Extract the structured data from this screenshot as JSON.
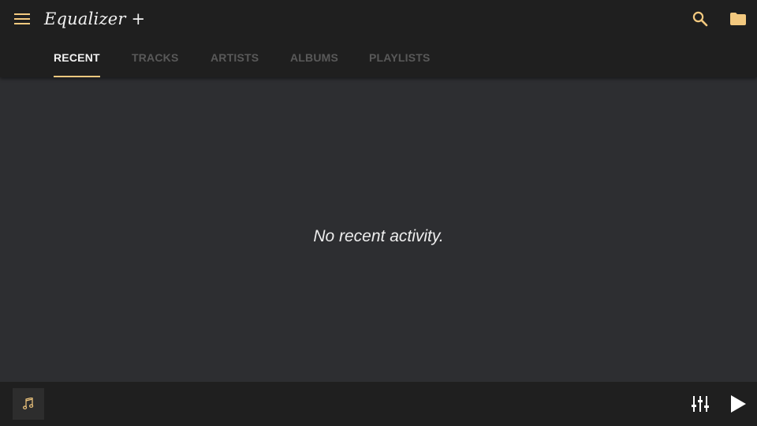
{
  "app": {
    "title": "Equalizer +"
  },
  "colors": {
    "accent": "#f3c97f",
    "topbar_bg": "#1f1f1f",
    "content_bg": "#2d2e31",
    "tab_inactive": "#595959",
    "text_primary": "#f2f2f2"
  },
  "icons": {
    "menu": "menu-icon",
    "search": "search-icon",
    "folder": "folder-icon",
    "music_note": "music-note-icon",
    "equalizer": "equalizer-sliders-icon",
    "play": "play-icon"
  },
  "tabs": [
    {
      "label": "RECENT",
      "active": true
    },
    {
      "label": "TRACKS",
      "active": false
    },
    {
      "label": "ARTISTS",
      "active": false
    },
    {
      "label": "ALBUMS",
      "active": false
    },
    {
      "label": "PLAYLISTS",
      "active": false
    }
  ],
  "main": {
    "empty_message": "No recent activity."
  }
}
